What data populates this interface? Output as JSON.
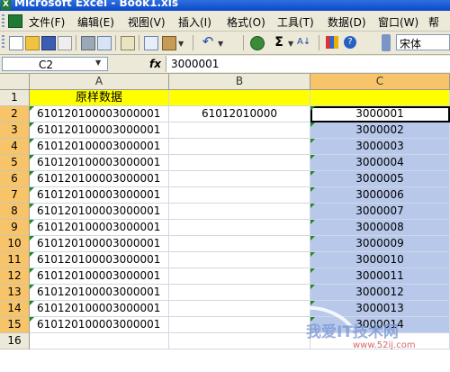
{
  "window": {
    "title": "Microsoft Excel - Book1.xls"
  },
  "menu": [
    "文件(F)",
    "编辑(E)",
    "视图(V)",
    "插入(I)",
    "格式(O)",
    "工具(T)",
    "数据(D)",
    "窗口(W)",
    "帮"
  ],
  "toolbar": {
    "font_name": "宋体"
  },
  "formula_bar": {
    "name_box": "C2",
    "fx": "fx",
    "value": "3000001"
  },
  "columns": [
    "A",
    "B",
    "C"
  ],
  "rows": [
    {
      "n": "1",
      "a": "原样数据",
      "b": "",
      "c": ""
    },
    {
      "n": "2",
      "a": "610120100003000001",
      "b": "61012010000",
      "c": "3000001"
    },
    {
      "n": "3",
      "a": "610120100003000001",
      "b": "",
      "c": "3000002"
    },
    {
      "n": "4",
      "a": "610120100003000001",
      "b": "",
      "c": "3000003"
    },
    {
      "n": "5",
      "a": "610120100003000001",
      "b": "",
      "c": "3000004"
    },
    {
      "n": "6",
      "a": "610120100003000001",
      "b": "",
      "c": "3000005"
    },
    {
      "n": "7",
      "a": "610120100003000001",
      "b": "",
      "c": "3000006"
    },
    {
      "n": "8",
      "a": "610120100003000001",
      "b": "",
      "c": "3000007"
    },
    {
      "n": "9",
      "a": "610120100003000001",
      "b": "",
      "c": "3000008"
    },
    {
      "n": "10",
      "a": "610120100003000001",
      "b": "",
      "c": "3000009"
    },
    {
      "n": "11",
      "a": "610120100003000001",
      "b": "",
      "c": "3000010"
    },
    {
      "n": "12",
      "a": "610120100003000001",
      "b": "",
      "c": "3000011"
    },
    {
      "n": "13",
      "a": "610120100003000001",
      "b": "",
      "c": "3000012"
    },
    {
      "n": "14",
      "a": "610120100003000001",
      "b": "",
      "c": "3000013"
    },
    {
      "n": "15",
      "a": "610120100003000001",
      "b": "",
      "c": "3000014"
    },
    {
      "n": "16",
      "a": "",
      "b": "",
      "c": ""
    }
  ],
  "watermark": {
    "text": "我爱IT技术网",
    "url": "www.52ij.com"
  }
}
